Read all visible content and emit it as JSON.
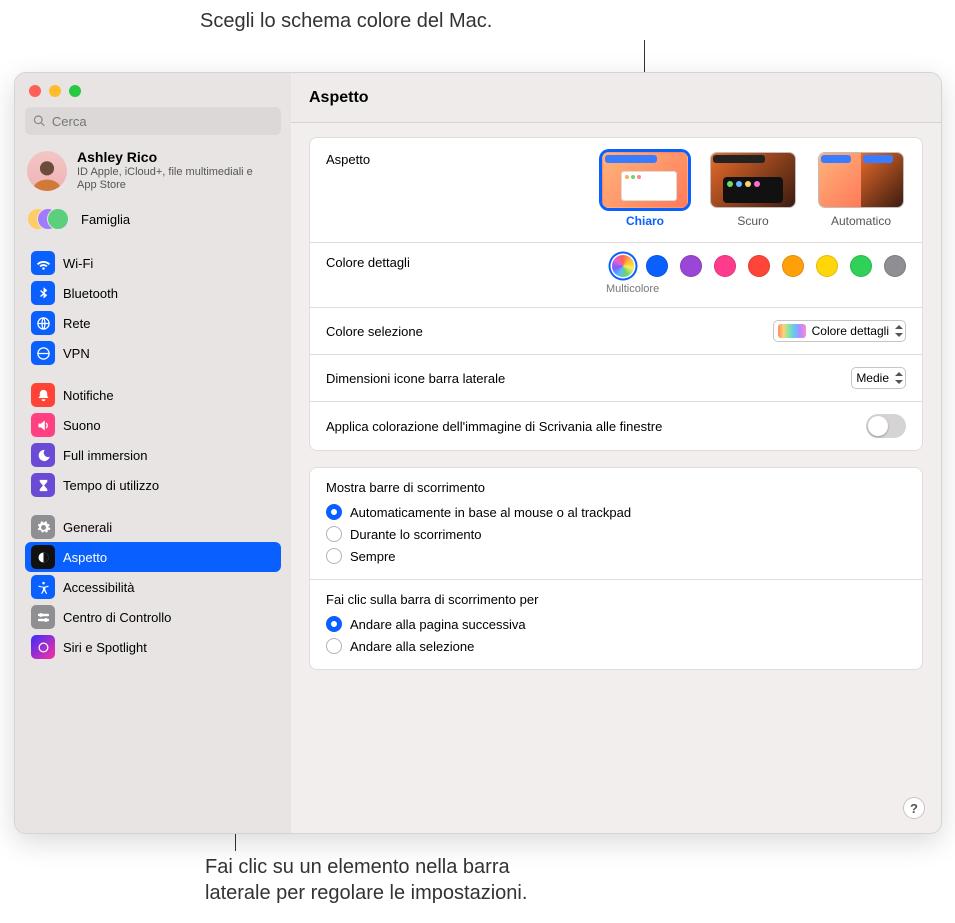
{
  "callouts": {
    "top": "Scegli lo schema colore del Mac.",
    "bottom": "Fai clic su un elemento nella barra\nlaterale per regolare le impostazioni."
  },
  "window": {
    "search_placeholder": "Cerca",
    "user": {
      "name": "Ashley Rico",
      "subtitle": "ID Apple, iCloud+, file multimediali e App Store"
    },
    "family_label": "Famiglia",
    "sidebar": {
      "items": [
        {
          "id": "wifi",
          "label": "Wi-Fi",
          "color": "#0a60ff"
        },
        {
          "id": "bluetooth",
          "label": "Bluetooth",
          "color": "#0a60ff"
        },
        {
          "id": "rete",
          "label": "Rete",
          "color": "#0a60ff"
        },
        {
          "id": "vpn",
          "label": "VPN",
          "color": "#0a60ff"
        },
        {
          "id": "notifiche",
          "label": "Notifiche",
          "color": "#ff4336"
        },
        {
          "id": "suono",
          "label": "Suono",
          "color": "#ff4182"
        },
        {
          "id": "fullimmersion",
          "label": "Full immersion",
          "color": "#6b4bd6"
        },
        {
          "id": "tempo",
          "label": "Tempo di utilizzo",
          "color": "#6b4bd6"
        },
        {
          "id": "generali",
          "label": "Generali",
          "color": "#8e8e93"
        },
        {
          "id": "aspetto",
          "label": "Aspetto",
          "color": "#111111",
          "selected": true
        },
        {
          "id": "accessibilita",
          "label": "Accessibilità",
          "color": "#0a60ff"
        },
        {
          "id": "controlcenter",
          "label": "Centro di Controllo",
          "color": "#8e8e93"
        },
        {
          "id": "siri",
          "label": "Siri e Spotlight",
          "color": "#111111"
        }
      ]
    }
  },
  "content": {
    "title": "Aspetto",
    "appearance": {
      "label": "Aspetto",
      "options": [
        {
          "id": "light",
          "label": "Chiaro",
          "selected": true
        },
        {
          "id": "dark",
          "label": "Scuro"
        },
        {
          "id": "auto",
          "label": "Automatico"
        }
      ]
    },
    "accent": {
      "label": "Colore dettagli",
      "selected_caption": "Multicolore",
      "colors": [
        "#multicolor",
        "#0a60ff",
        "#9a46d6",
        "#ff3b8d",
        "#ff453a",
        "#ff9f0a",
        "#ffd60a",
        "#30d158",
        "#8e8e93"
      ]
    },
    "highlight": {
      "label": "Colore selezione",
      "value": "Colore dettagli"
    },
    "sidebar_icons": {
      "label": "Dimensioni icone barra laterale",
      "value": "Medie"
    },
    "tint": {
      "label": "Applica colorazione dell'immagine di Scrivania alle finestre",
      "value": false
    },
    "scroll_show": {
      "header": "Mostra barre di scorrimento",
      "options": [
        {
          "label": "Automaticamente in base al mouse o al trackpad",
          "checked": true
        },
        {
          "label": "Durante lo scorrimento",
          "checked": false
        },
        {
          "label": "Sempre",
          "checked": false
        }
      ]
    },
    "scroll_click": {
      "header": "Fai clic sulla barra di scorrimento per",
      "options": [
        {
          "label": "Andare alla pagina successiva",
          "checked": true
        },
        {
          "label": "Andare alla selezione",
          "checked": false
        }
      ]
    },
    "help_symbol": "?"
  }
}
